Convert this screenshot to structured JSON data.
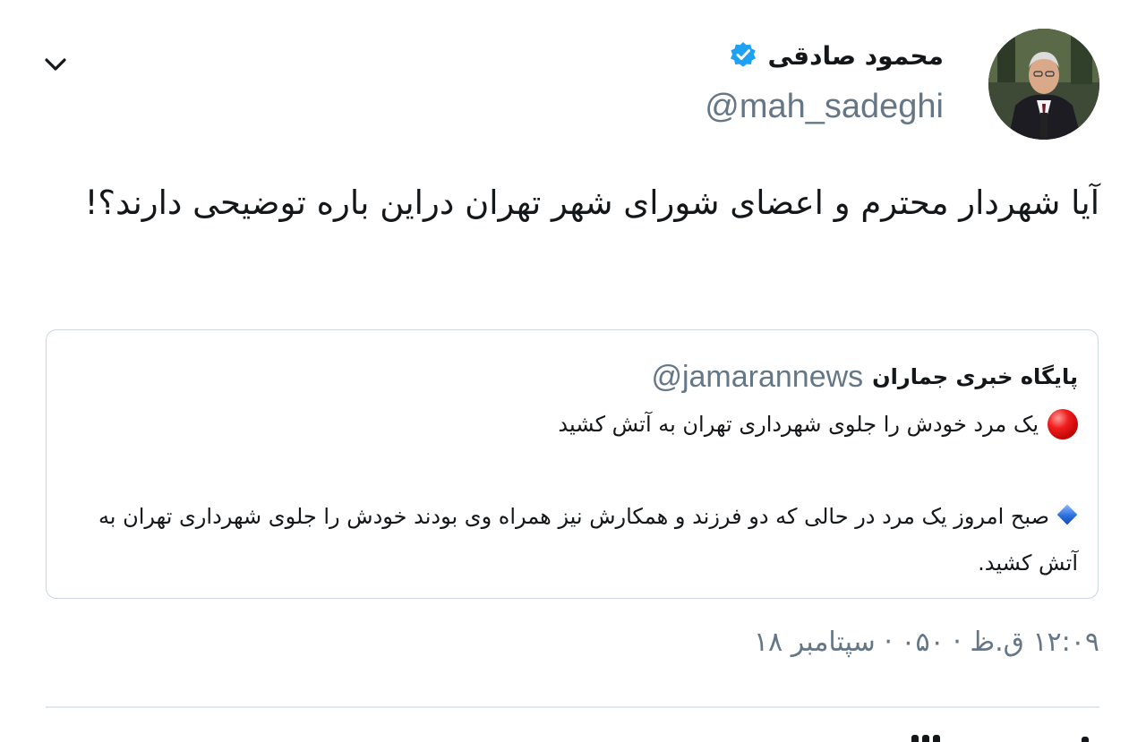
{
  "author": {
    "display_name": "محمود صادقی",
    "handle": "@mah_sadeghi",
    "verified": true,
    "avatar_icon": "profile-photo"
  },
  "tweet": {
    "text": "آیا شهردار محترم و اعضای شورای شهر تهران دراین باره توضیحی دارند؟!"
  },
  "quoted_tweet": {
    "display_name": "پایگاه خبری جماران",
    "handle": "@jamarannews",
    "headline": "یک مرد خودش را جلوی شهرداری تهران به آتش کشید",
    "headline_icon": "red-circle-icon",
    "body": "صبح امروز یک مرد در حالی که دو فرزند و همکارش نیز همراه وی بودند خودش را جلوی شهرداری تهران به آتش کشید.",
    "body_icon": "blue-diamond-icon"
  },
  "timestamp": "۱۲:۰۹ ق.ظ · ۰۵۰ · سپتامبر ۱۸",
  "colors": {
    "text": "#14171a",
    "secondary_text": "#657786",
    "verified_blue": "#1da1f2",
    "border": "#ccd6dd",
    "divider": "#e1e8ed",
    "red_circle": "#e0161a",
    "blue_diamond": "#2b6fe0"
  }
}
